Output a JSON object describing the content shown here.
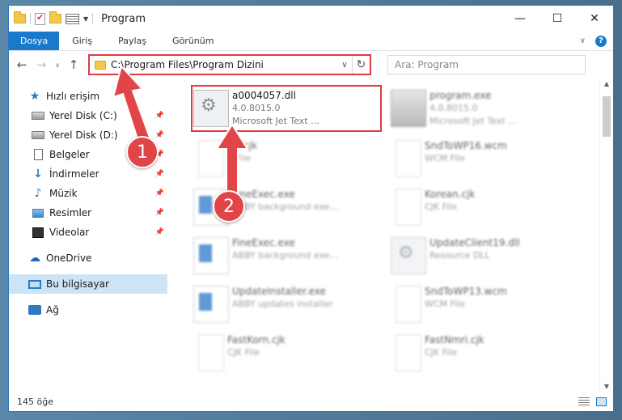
{
  "window": {
    "title": "Program"
  },
  "ribbon": {
    "tabs": [
      "Dosya",
      "Giriş",
      "Paylaş",
      "Görünüm"
    ],
    "help": "?"
  },
  "address": {
    "path": "C:\\Program Files\\Program Dizini",
    "search_placeholder": "Ara: Program"
  },
  "nav": {
    "items": [
      {
        "label": "Hızlı erişim",
        "icon": "star-icon"
      },
      {
        "label": "Yerel Disk (C:)",
        "icon": "disk-icon",
        "pinned": true
      },
      {
        "label": "Yerel Disk (D:)",
        "icon": "disk-icon",
        "pinned": true
      },
      {
        "label": "Belgeler",
        "icon": "document-icon",
        "pinned": true
      },
      {
        "label": "İndirmeler",
        "icon": "download-icon",
        "pinned": true
      },
      {
        "label": "Müzik",
        "icon": "music-icon",
        "pinned": true
      },
      {
        "label": "Resimler",
        "icon": "picture-icon",
        "pinned": true
      },
      {
        "label": "Videolar",
        "icon": "video-icon",
        "pinned": true
      },
      {
        "label": "OneDrive",
        "icon": "cloud-icon"
      },
      {
        "label": "Bu bilgisayar",
        "icon": "computer-icon",
        "selected": true
      },
      {
        "label": "Ağ",
        "icon": "network-icon"
      }
    ]
  },
  "files": [
    {
      "name": "a0004057.dll",
      "line2": "4.0.8015.0",
      "line3": "Microsoft Jet Text ..."
    },
    {
      "name": "program.exe",
      "line2": "4.0.8015.0",
      "line3": "Microsoft Jet Text ..."
    },
    {
      "name": "...t.cjk",
      "line2": "...File"
    },
    {
      "name": "SndToWP16.wcm",
      "line2": "WCM File"
    },
    {
      "name": "FineExec.exe",
      "line2": "ABBY background exe..."
    },
    {
      "name": "Korean.cjk",
      "line2": "CJK File"
    },
    {
      "name": "FineExec.exe",
      "line2": "ABBY background exe..."
    },
    {
      "name": "UpdateClient19.dll",
      "line2": "Resource DLL"
    },
    {
      "name": "UpdateInstaller.exe",
      "line2": "ABBY updates installer"
    },
    {
      "name": "SndToWP13.wcm",
      "line2": "WCM File"
    },
    {
      "name": "FastKorn.cjk",
      "line2": "CJK File"
    },
    {
      "name": "FastNmri.cjk",
      "line2": "CJK File"
    }
  ],
  "status": {
    "count": "145 öğe"
  },
  "callouts": {
    "one": "1",
    "two": "2"
  }
}
